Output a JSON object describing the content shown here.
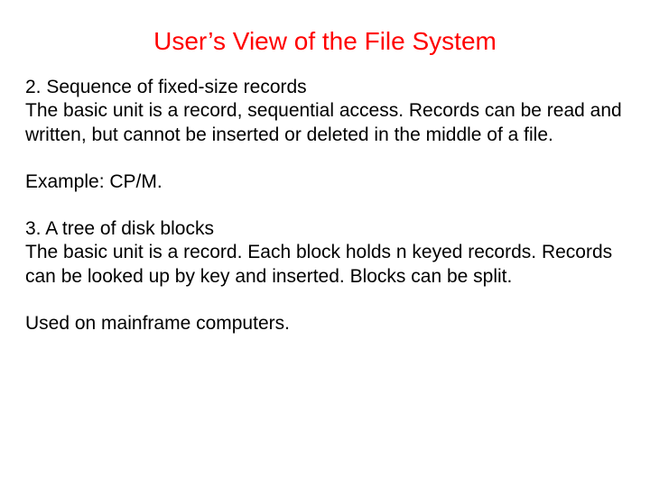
{
  "title": "User’s View of the File System",
  "section2_heading": "2. Sequence of fixed-size records",
  "section2_body": "The basic unit is a record, sequential access. Records can be read and written, but cannot be inserted or deleted in the middle of a file.",
  "section2_example": "Example: CP/M.",
  "section3_heading": "3. A tree of disk blocks",
  "section3_body": "The basic unit is a record. Each block holds n keyed records. Records can be looked up by key and inserted. Blocks can be split.",
  "section3_note": "Used on mainframe computers."
}
